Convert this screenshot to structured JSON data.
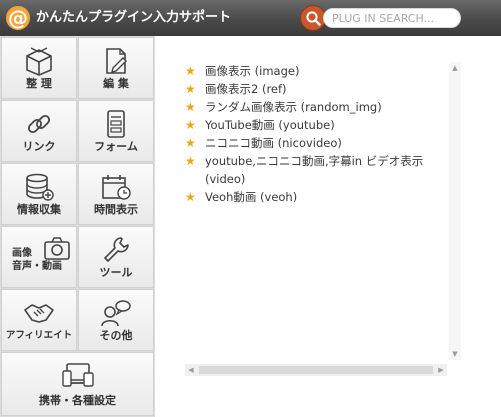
{
  "header": {
    "logo_glyph": "@",
    "title": "かんたんプラグイン入力サポート",
    "search_placeholder": "PLUG IN SEARCH..."
  },
  "sidebar": {
    "items": [
      {
        "label": "整 理",
        "icon": "box-icon"
      },
      {
        "label": "編 集",
        "icon": "edit-document-icon"
      },
      {
        "label": "リンク",
        "icon": "link-icon"
      },
      {
        "label": "フォーム",
        "icon": "form-icon"
      },
      {
        "label": "情報収集",
        "icon": "database-icon"
      },
      {
        "label": "時間表示",
        "icon": "calendar-clock-icon"
      },
      {
        "label_line1": "画像",
        "label_line2": "音声・動画",
        "icon": "camera-icon"
      },
      {
        "label": "ツール",
        "icon": "wrench-icon"
      },
      {
        "label": "アフィリエイト",
        "icon": "handshake-icon"
      },
      {
        "label": "その他",
        "icon": "speech-person-icon"
      },
      {
        "label": "携帯・各種設定",
        "icon": "devices-icon"
      }
    ]
  },
  "plugins": [
    "画像表示 (image)",
    "画像表示2 (ref)",
    "ランダム画像表示 (random_img)",
    "YouTube動画 (youtube)",
    "ニコニコ動画 (nicovideo)",
    "youtube,ニコニコ動画,字幕in ビデオ表示 (video)",
    "Veoh動画 (veoh)"
  ],
  "colors": {
    "header": "#4a4a4a",
    "accent_orange": "#f3a53a",
    "search_button": "#c8572a",
    "star": "#e8a817"
  }
}
